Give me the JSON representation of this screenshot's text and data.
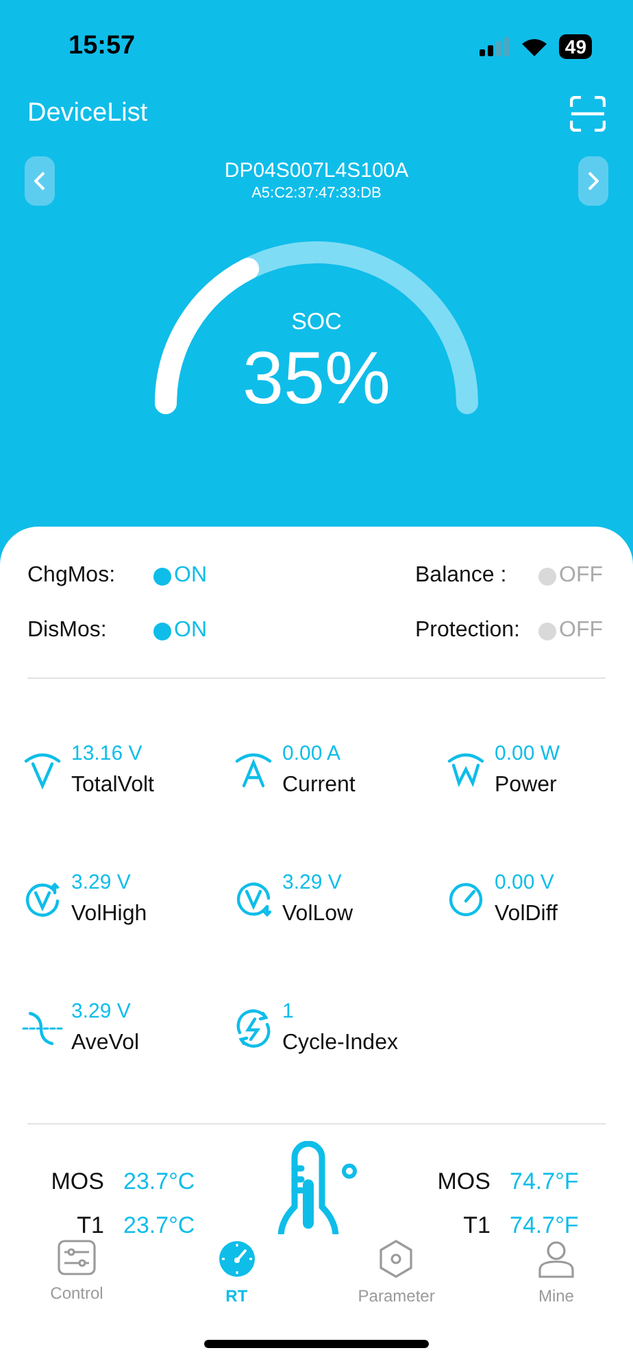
{
  "status_bar": {
    "time": "15:57",
    "battery": "49"
  },
  "header": {
    "title": "DeviceList"
  },
  "device": {
    "name": "DP04S007L4S100A",
    "mac": "A5:C2:37:47:33:DB"
  },
  "soc": {
    "label": "SOC",
    "value": "35%"
  },
  "switches": [
    {
      "label": "ChgMos:",
      "state": "ON",
      "on": true
    },
    {
      "label": "Balance :",
      "state": "OFF",
      "on": false
    },
    {
      "label": "DisMos:",
      "state": "ON",
      "on": true
    },
    {
      "label": "Protection:",
      "state": "OFF",
      "on": false
    }
  ],
  "metrics": [
    {
      "kind": "volt",
      "value": "13.16 V",
      "label": "TotalVolt"
    },
    {
      "kind": "amp",
      "value": "0.00 A",
      "label": "Current"
    },
    {
      "kind": "watt",
      "value": "0.00 W",
      "label": "Power"
    },
    {
      "kind": "high",
      "value": "3.29 V",
      "label": "VolHigh"
    },
    {
      "kind": "low",
      "value": "3.29 V",
      "label": "VolLow"
    },
    {
      "kind": "diff",
      "value": "0.00 V",
      "label": "VolDiff"
    },
    {
      "kind": "ave",
      "value": "3.29 V",
      "label": "AveVol"
    },
    {
      "kind": "cycle",
      "value": "1",
      "label": "Cycle-Index"
    }
  ],
  "temperatures": [
    {
      "left_label": "MOS",
      "left_value": "23.7°C",
      "right_label": "MOS",
      "right_value": "74.7°F"
    },
    {
      "left_label": "T1",
      "left_value": "23.7°C",
      "right_label": "T1",
      "right_value": "74.7°F"
    }
  ],
  "tabs": [
    {
      "kind": "control",
      "label": "Control",
      "selected": false
    },
    {
      "kind": "rt",
      "label": "RT",
      "selected": true
    },
    {
      "kind": "parameter",
      "label": "Parameter",
      "selected": false
    },
    {
      "kind": "mine",
      "label": "Mine",
      "selected": false
    }
  ]
}
